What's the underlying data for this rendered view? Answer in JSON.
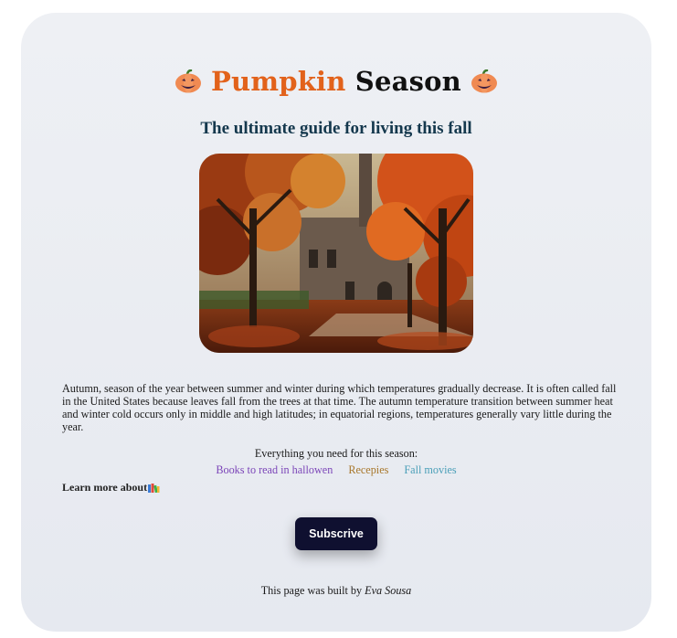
{
  "header": {
    "title_accent": "Pumpkin",
    "title_rest": "Season",
    "title_icon": "pumpkin-emoji",
    "subtitle": "The ultimate guide for living this fall"
  },
  "hero_image": {
    "subject": "autumn trees in front of a gothic stone building"
  },
  "content": {
    "description": "Autumn, season of the year between summer and winter during which temperatures gradually decrease. It is often called fall in the United States because leaves fall from the trees at that time. The autumn temperature transition between summer heat and winter cold occurs only in middle and high latitudes; in equatorial regions, temperatures generally vary little during the year.",
    "need_label": "Everything you need for this season:",
    "links": [
      {
        "label": "Books to read in hallowen",
        "color": "#7b45b8"
      },
      {
        "label": "Recepies",
        "color": "#a8782c"
      },
      {
        "label": "Fall movies",
        "color": "#4a9fb8"
      }
    ],
    "learn_more": "Learn more about",
    "learn_more_icon": "books-icon"
  },
  "actions": {
    "subscribe_label": "Subscrive"
  },
  "footer": {
    "text": "This page was built by",
    "author": "Eva Sousa"
  },
  "colors": {
    "accent": "#e2621b",
    "subtitle": "#14384d",
    "button_bg": "#0f1030"
  }
}
